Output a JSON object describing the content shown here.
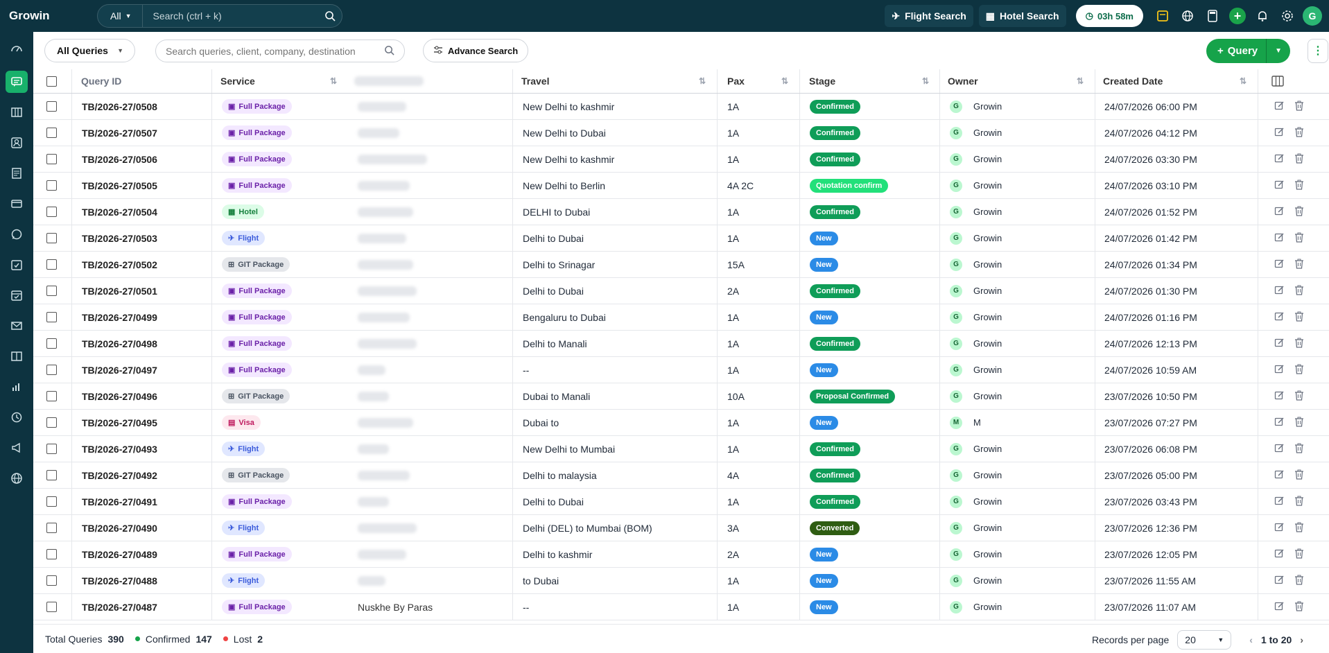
{
  "topbar": {
    "brand": "Growin",
    "search_scope": "All",
    "search_placeholder": "Search (ctrl + k)",
    "flight_search": "Flight Search",
    "hotel_search": "Hotel Search",
    "timer": "03h 58m",
    "avatar": "G"
  },
  "toolbar": {
    "filter_label": "All Queries",
    "search_placeholder": "Search queries, client, company, destination",
    "advance_search": "Advance Search",
    "query_button": "Query"
  },
  "table": {
    "headers": {
      "query_id": "Query ID",
      "service": "Service",
      "travel": "Travel",
      "pax": "Pax",
      "stage": "Stage",
      "owner": "Owner",
      "created": "Created Date"
    },
    "rows": [
      {
        "id": "TB/2026-27/0508",
        "service": "Full Package",
        "travel": "New Delhi to kashmir",
        "pax": "1A",
        "stage": "Confirmed",
        "owner_initial": "G",
        "owner": "Growin",
        "date": "24/07/2026 06:00 PM",
        "client": ""
      },
      {
        "id": "TB/2026-27/0507",
        "service": "Full Package",
        "travel": "New Delhi to Dubai",
        "pax": "1A",
        "stage": "Confirmed",
        "owner_initial": "G",
        "owner": "Growin",
        "date": "24/07/2026 04:12 PM",
        "client": ""
      },
      {
        "id": "TB/2026-27/0506",
        "service": "Full Package",
        "travel": "New Delhi to kashmir",
        "pax": "1A",
        "stage": "Confirmed",
        "owner_initial": "G",
        "owner": "Growin",
        "date": "24/07/2026 03:30 PM",
        "client": ""
      },
      {
        "id": "TB/2026-27/0505",
        "service": "Full Package",
        "travel": "New Delhi to Berlin",
        "pax": "4A 2C",
        "stage": "Quotation confirm",
        "owner_initial": "G",
        "owner": "Growin",
        "date": "24/07/2026 03:10 PM",
        "client": ""
      },
      {
        "id": "TB/2026-27/0504",
        "service": "Hotel",
        "travel": "DELHI to Dubai",
        "pax": "1A",
        "stage": "Confirmed",
        "owner_initial": "G",
        "owner": "Growin",
        "date": "24/07/2026 01:52 PM",
        "client": ""
      },
      {
        "id": "TB/2026-27/0503",
        "service": "Flight",
        "travel": "Delhi to Dubai",
        "pax": "1A",
        "stage": "New",
        "owner_initial": "G",
        "owner": "Growin",
        "date": "24/07/2026 01:42 PM",
        "client": ""
      },
      {
        "id": "TB/2026-27/0502",
        "service": "GIT Package",
        "travel": "Delhi to Srinagar",
        "pax": "15A",
        "stage": "New",
        "owner_initial": "G",
        "owner": "Growin",
        "date": "24/07/2026 01:34 PM",
        "client": ""
      },
      {
        "id": "TB/2026-27/0501",
        "service": "Full Package",
        "travel": "Delhi to Dubai",
        "pax": "2A",
        "stage": "Confirmed",
        "owner_initial": "G",
        "owner": "Growin",
        "date": "24/07/2026 01:30 PM",
        "client": ""
      },
      {
        "id": "TB/2026-27/0499",
        "service": "Full Package",
        "travel": "Bengaluru to Dubai",
        "pax": "1A",
        "stage": "New",
        "owner_initial": "G",
        "owner": "Growin",
        "date": "24/07/2026 01:16 PM",
        "client": ""
      },
      {
        "id": "TB/2026-27/0498",
        "service": "Full Package",
        "travel": "Delhi to Manali",
        "pax": "1A",
        "stage": "Confirmed",
        "owner_initial": "G",
        "owner": "Growin",
        "date": "24/07/2026 12:13 PM",
        "client": ""
      },
      {
        "id": "TB/2026-27/0497",
        "service": "Full Package",
        "travel": "--",
        "pax": "1A",
        "stage": "New",
        "owner_initial": "G",
        "owner": "Growin",
        "date": "24/07/2026 10:59 AM",
        "client": ""
      },
      {
        "id": "TB/2026-27/0496",
        "service": "GIT Package",
        "travel": "Dubai to Manali",
        "pax": "10A",
        "stage": "Proposal Confirmed",
        "owner_initial": "G",
        "owner": "Growin",
        "date": "23/07/2026 10:50 PM",
        "client": ""
      },
      {
        "id": "TB/2026-27/0495",
        "service": "Visa",
        "travel": "Dubai to",
        "pax": "1A",
        "stage": "New",
        "owner_initial": "M",
        "owner": "M",
        "date": "23/07/2026 07:27 PM",
        "client": ""
      },
      {
        "id": "TB/2026-27/0493",
        "service": "Flight",
        "travel": "New Delhi to Mumbai",
        "pax": "1A",
        "stage": "Confirmed",
        "owner_initial": "G",
        "owner": "Growin",
        "date": "23/07/2026 06:08 PM",
        "client": ""
      },
      {
        "id": "TB/2026-27/0492",
        "service": "GIT Package",
        "travel": "Delhi to malaysia",
        "pax": "4A",
        "stage": "Confirmed",
        "owner_initial": "G",
        "owner": "Growin",
        "date": "23/07/2026 05:00 PM",
        "client": ""
      },
      {
        "id": "TB/2026-27/0491",
        "service": "Full Package",
        "travel": "Delhi to Dubai",
        "pax": "1A",
        "stage": "Confirmed",
        "owner_initial": "G",
        "owner": "Growin",
        "date": "23/07/2026 03:43 PM",
        "client": ""
      },
      {
        "id": "TB/2026-27/0490",
        "service": "Flight",
        "travel": "Delhi (DEL) to Mumbai (BOM)",
        "pax": "3A",
        "stage": "Converted",
        "owner_initial": "G",
        "owner": "Growin",
        "date": "23/07/2026 12:36 PM",
        "client": ""
      },
      {
        "id": "TB/2026-27/0489",
        "service": "Full Package",
        "travel": "Delhi to kashmir",
        "pax": "2A",
        "stage": "New",
        "owner_initial": "G",
        "owner": "Growin",
        "date": "23/07/2026 12:05 PM",
        "client": ""
      },
      {
        "id": "TB/2026-27/0488",
        "service": "Flight",
        "travel": "to Dubai",
        "pax": "1A",
        "stage": "New",
        "owner_initial": "G",
        "owner": "Growin",
        "date": "23/07/2026 11:55 AM",
        "client": ""
      },
      {
        "id": "TB/2026-27/0487",
        "service": "Full Package",
        "travel": "--",
        "pax": "1A",
        "stage": "New",
        "owner_initial": "G",
        "owner": "Growin",
        "date": "23/07/2026 11:07 AM",
        "client": "Nuskhe By Paras"
      }
    ]
  },
  "stage_colors": {
    "Confirmed": "#0f9d58",
    "New": "#2b8be6",
    "Quotation confirm": "#22e07a",
    "Proposal Confirmed": "#0f9d58",
    "Converted": "#2f5d12"
  },
  "footer": {
    "total_label": "Total Queries",
    "total": "390",
    "confirmed_label": "Confirmed",
    "confirmed": "147",
    "lost_label": "Lost",
    "lost": "2",
    "rpp_label": "Records per page",
    "rpp_value": "20",
    "range": "1 to 20"
  },
  "sidebar_icons": [
    "dashboard-icon",
    "chat-icon",
    "map-icon",
    "contact-icon",
    "invoice-icon",
    "card-icon",
    "whatsapp-icon",
    "task-icon",
    "calendar-check-icon",
    "mail-icon",
    "book-icon",
    "chart-icon",
    "clock-icon",
    "megaphone-icon",
    "globe-icon"
  ]
}
